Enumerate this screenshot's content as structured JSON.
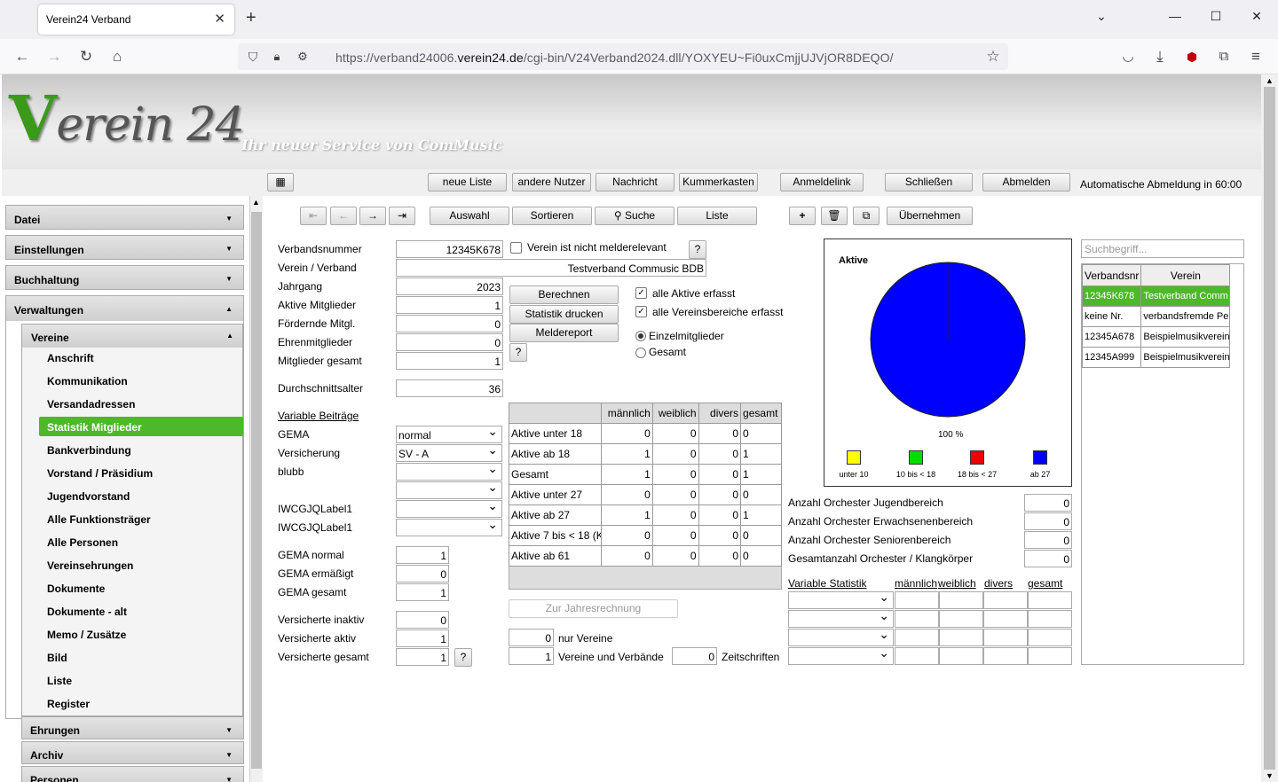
{
  "browser": {
    "tab_title": "Verein24 Verband",
    "url_prefix": "https://verband24006.",
    "url_domain": "verein24.de",
    "url_suffix": "/cgi-bin/V24Verband2024.dll/YOXYEU~Fi0uxCmjjUJVjOR8DEQO/"
  },
  "header": {
    "logo_v": "V",
    "logo_rest": "erein 24",
    "tagline": "Ihr neuer Service von ComMusic"
  },
  "toolbar": {
    "neue_liste": "neue Liste",
    "andere_nutzer": "andere Nutzer",
    "nachricht": "Nachricht",
    "kummerkasten": "Kummerkasten",
    "anmeldelink": "Anmeldelink",
    "schliessen": "Schließen",
    "abmelden": "Abmelden",
    "autologout": "Automatische Abmeldung in 60:00"
  },
  "nav": {
    "auswahl": "Auswahl",
    "sortieren": "Sortieren",
    "suche": "Suche",
    "liste": "Liste",
    "uebernehmen": "Übernehmen"
  },
  "sidebar": {
    "sections": [
      "Datei",
      "Einstellungen",
      "Buchhaltung",
      "Verwaltungen"
    ],
    "subsection": "Vereine",
    "items": [
      "Anschrift",
      "Kommunikation",
      "Versandadressen",
      "Statistik Mitglieder",
      "Bankverbindung",
      "Vorstand / Präsidium",
      "Jugendvorstand",
      "Alle Funktionsträger",
      "Alle Personen",
      "Vereinsehrungen",
      "Dokumente",
      "Dokumente - alt",
      "Memo / Zusätze",
      "Bild",
      "Liste",
      "Register"
    ],
    "active_item": "Statistik Mitglieder",
    "bottom_sections": [
      "Ehrungen",
      "Archiv",
      "Personen"
    ]
  },
  "form": {
    "verbandsnummer_label": "Verbandsnummer",
    "verbandsnummer": "12345K678",
    "verein_label": "Verein / Verband",
    "verein": "Testverband Commusic BDB",
    "jahrgang_label": "Jahrgang",
    "jahrgang": "2023",
    "aktive_label": "Aktive Mitglieder",
    "aktive": "1",
    "foerdernde_label": "Fördernde Mitgl.",
    "foerdernde": "0",
    "ehren_label": "Ehrenmitglieder",
    "ehren": "0",
    "gesamt_label": "Mitglieder gesamt",
    "gesamt": "1",
    "durchschnitt_label": "Durchschnittsalter",
    "durchschnitt": "36",
    "nicht_melderelevant": "Verein ist nicht melderelevant",
    "help": "?",
    "berechnen": "Berechnen",
    "statistik_drucken": "Statistik drucken",
    "meldereport": "Meldereport",
    "alle_aktive": "alle Aktive erfasst",
    "alle_bereiche": "alle Vereinsbereiche erfasst",
    "einzel": "Einzelmitglieder",
    "gesamt_radio": "Gesamt",
    "variable_beitraege": "Variable Beiträge",
    "gema_label": "GEMA",
    "gema_value": "normal",
    "versicherung_label": "Versicherung",
    "versicherung_value": "SV - A",
    "blubb_label": "blubb",
    "iwc1_label": "IWCGJQLabel1",
    "iwc2_label": "IWCGJQLabel1",
    "gema_normal_label": "GEMA normal",
    "gema_normal": "1",
    "gema_erm_label": "GEMA ermäßigt",
    "gema_erm": "0",
    "gema_ges_label": "GEMA gesamt",
    "gema_ges": "1",
    "vers_inaktiv_label": "Versicherte inaktiv",
    "vers_inaktiv": "0",
    "vers_aktiv_label": "Versicherte aktiv",
    "vers_aktiv": "1",
    "vers_ges_label": "Versicherte gesamt",
    "vers_ges": "1",
    "zur_jahresrechnung": "Zur Jahresrechnung",
    "nur_vereine_val": "0",
    "nur_vereine": "nur Vereine",
    "vereine_verbaende_val": "1",
    "vereine_verbaende": "Vereine und Verbände",
    "zeitschriften_val": "0",
    "zeitschriften": "Zeitschriften"
  },
  "stats_table": {
    "headers": [
      "männlich",
      "weiblich",
      "divers",
      "gesamt"
    ],
    "rows": [
      {
        "label": "Aktive unter 18",
        "m": "0",
        "w": "0",
        "d": "0",
        "g": "0"
      },
      {
        "label": "Aktive ab 18",
        "m": "1",
        "w": "0",
        "d": "0",
        "g": "1"
      },
      {
        "label": "Gesamt",
        "m": "1",
        "w": "0",
        "d": "0",
        "g": "1"
      },
      {
        "label": "Aktive unter 27",
        "m": "0",
        "w": "0",
        "d": "0",
        "g": "0"
      },
      {
        "label": "Aktive ab 27",
        "m": "1",
        "w": "0",
        "d": "0",
        "g": "1"
      },
      {
        "label": "Aktive 7 bis < 18 (K",
        "m": "0",
        "w": "0",
        "d": "0",
        "g": "0"
      },
      {
        "label": "Aktive ab 61",
        "m": "0",
        "w": "0",
        "d": "0",
        "g": "0"
      }
    ]
  },
  "chart_data": {
    "type": "pie",
    "title": "Aktive",
    "categories": [
      "unter 10",
      "10 bis < 18",
      "18 bis < 27",
      "ab 27"
    ],
    "values": [
      0,
      0,
      0,
      100
    ],
    "colors": [
      "#ffff00",
      "#00dd00",
      "#ee0000",
      "#0000ff"
    ],
    "slice_label": "100 %"
  },
  "orchester": {
    "jugend_label": "Anzahl Orchester Jugendbereich",
    "jugend": "0",
    "erwachsen_label": "Anzahl Orchester Erwachsenenbereich",
    "erwachsen": "0",
    "senioren_label": "Anzahl Orchester Seniorenbereich",
    "senioren": "0",
    "gesamt_label": "Gesamtanzahl Orchester / Klangkörper",
    "gesamt": "0"
  },
  "variable_statistik": {
    "title": "Variable Statistik",
    "headers": [
      "männlich",
      "weiblich",
      "divers",
      "gesamt"
    ]
  },
  "search": {
    "placeholder": "Suchbegriff...",
    "col1": "Verbandsnr",
    "col2": "Verein",
    "rows": [
      {
        "nr": "12345K678",
        "name": "Testverband Comm"
      },
      {
        "nr": "keine Nr.",
        "name": "verbandsfremde Pe"
      },
      {
        "nr": "12345A678",
        "name": "Beispielmusikverein"
      },
      {
        "nr": "12345A999",
        "name": "Beispielmusikverein"
      }
    ]
  }
}
